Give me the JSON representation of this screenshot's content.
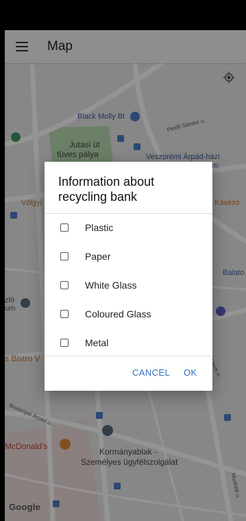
{
  "app": {
    "title": "Map"
  },
  "icons": {
    "menu": "hamburger-menu-icon",
    "location": "my-location-icon"
  },
  "map": {
    "labels": {
      "black_molly": "Black Molly Bt",
      "petofi": "Petőfi Sándor u.",
      "jutasi_1": "Jutasi út",
      "jutasi_2": "füves pálya",
      "veszpremi_1": "Veszprémi Árpád-házi",
      "veszpremi_2": "om",
      "volgyi": "Völgyi",
      "kavezo": "Kávézó",
      "balato": "Balato",
      "zlo_1": "zló",
      "zlo_2": "um",
      "bistro": "s Bistro V",
      "bruszny": "Brusznyai Árpád u.",
      "mcdonalds": "McDonald's",
      "kormany_1": "Kormányablak -",
      "kormany_2": "Személyes ügyfélszolgálat",
      "muskatli": "Muskátli u.",
      "janos": "János u.",
      "google": "Google"
    }
  },
  "dialog": {
    "title": "Information about recycling bank",
    "options": [
      "Plastic",
      "Paper",
      "White Glass",
      "Coloured Glass",
      "Metal"
    ],
    "cancel_label": "CANCEL",
    "ok_label": "OK"
  },
  "colors": {
    "accent": "#2f6fc0",
    "park": "#a8d5a1",
    "marker_blue": "#4a7ec9",
    "marker_orange": "#e0893a"
  }
}
